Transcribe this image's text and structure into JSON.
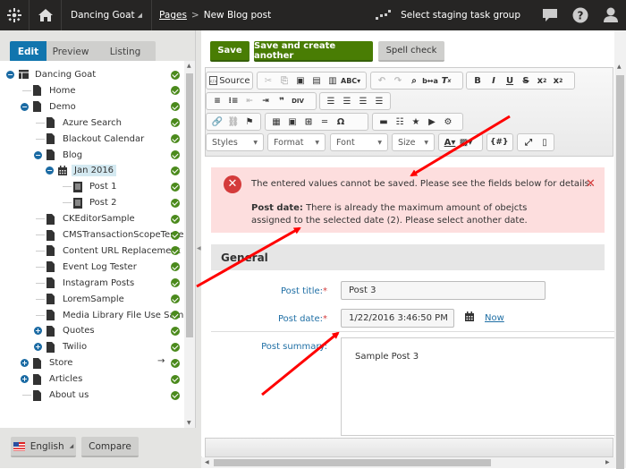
{
  "topbar": {
    "site_name": "Dancing Goat",
    "breadcrumb_root": "Pages",
    "breadcrumb_sep": ">",
    "breadcrumb_current": "New Blog post",
    "staging_label": "Select staging task group",
    "icons": [
      "kentico-logo-icon",
      "home-icon",
      "staging-icon",
      "chat-icon",
      "help-icon",
      "user-icon"
    ]
  },
  "left_panel": {
    "tabs": [
      {
        "label": "Edit",
        "active": true
      },
      {
        "label": "Preview",
        "active": false
      },
      {
        "label": "Listing",
        "active": false
      }
    ],
    "tree_tools": [
      {
        "icon": "plus-icon",
        "glyph": "+"
      },
      {
        "icon": "delete-icon",
        "glyph": "🗑"
      },
      {
        "icon": "copy-icon",
        "glyph": "⎘"
      },
      {
        "icon": "move-icon",
        "glyph": "▤"
      },
      {
        "icon": "move-up-icon",
        "glyph": "⌃"
      },
      {
        "icon": "move-down-icon",
        "glyph": "⌄"
      },
      {
        "icon": "search-icon",
        "glyph": "⌕"
      }
    ],
    "tree": [
      {
        "label": "Dancing Goat",
        "level": 0,
        "toggle": "-",
        "icon": "site-icon"
      },
      {
        "label": "Home",
        "level": 1,
        "toggle": "",
        "icon": "page-icon"
      },
      {
        "label": "Demo",
        "level": 1,
        "toggle": "-",
        "icon": "page-icon"
      },
      {
        "label": "Azure Search",
        "level": 2,
        "toggle": "",
        "icon": "page-icon"
      },
      {
        "label": "Blackout Calendar",
        "level": 2,
        "toggle": "",
        "icon": "page-icon"
      },
      {
        "label": "Blog",
        "level": 2,
        "toggle": "-",
        "icon": "page-icon"
      },
      {
        "label": "Jan 2016",
        "level": 3,
        "toggle": "-",
        "icon": "calendar-icon",
        "selected": true
      },
      {
        "label": "Post 1",
        "level": 4,
        "toggle": "",
        "icon": "post-icon"
      },
      {
        "label": "Post 2",
        "level": 4,
        "toggle": "",
        "icon": "post-icon"
      },
      {
        "label": "CKEditorSample",
        "level": 2,
        "toggle": "",
        "icon": "page-icon"
      },
      {
        "label": "CMSTransactionScopeTeste",
        "level": 2,
        "toggle": "",
        "icon": "page-icon"
      },
      {
        "label": "Content URL Replacement",
        "level": 2,
        "toggle": "",
        "icon": "page-icon"
      },
      {
        "label": "Event Log Tester",
        "level": 2,
        "toggle": "",
        "icon": "page-icon"
      },
      {
        "label": "Instagram Posts",
        "level": 2,
        "toggle": "",
        "icon": "page-icon"
      },
      {
        "label": "LoremSample",
        "level": 2,
        "toggle": "",
        "icon": "page-icon"
      },
      {
        "label": "Media Library File Use Sam",
        "level": 2,
        "toggle": "",
        "icon": "page-icon"
      },
      {
        "label": "Quotes",
        "level": 2,
        "toggle": "+",
        "icon": "page-icon"
      },
      {
        "label": "Twilio",
        "level": 2,
        "toggle": "+",
        "icon": "page-icon"
      },
      {
        "label": "Store",
        "level": 1,
        "toggle": "+",
        "icon": "page-icon",
        "link_arrow": "→"
      },
      {
        "label": "Articles",
        "level": 1,
        "toggle": "+",
        "icon": "page-icon"
      },
      {
        "label": "About us",
        "level": 1,
        "toggle": "",
        "icon": "page-icon"
      }
    ],
    "language": "English",
    "compare_label": "Compare"
  },
  "toolbar": {
    "save_label": "Save",
    "save_create_label": "Save and create another",
    "spell_check_label": "Spell check"
  },
  "editor": {
    "source_label": "Source",
    "combos": [
      "Styles",
      "Format",
      "Font",
      "Size"
    ],
    "var_label": "{#}"
  },
  "alert": {
    "message": "The entered values cannot be saved. Please see the fields below for details.",
    "detail_label": "Post date:",
    "detail_text": " There is already the maximum amount of obejcts assigned to the selected date (2). Please select another date.",
    "close_glyph": "✕",
    "error_glyph": "✕",
    "color": "#d43b3b"
  },
  "form": {
    "section_title": "General",
    "post_title_label": "Post title:",
    "post_title_value": "Post 3",
    "post_date_label": "Post date:",
    "post_date_value": "1/22/2016 3:46:50 PM",
    "now_label": "Now",
    "post_summary_label": "Post summary:",
    "post_summary_value": "Sample Post 3",
    "required_mark": "*"
  },
  "colors": {
    "accent_blue": "#1175ae",
    "save_green": "#497d04",
    "status_ok": "#4b8a1c",
    "annotation_red": "#ff0000"
  }
}
